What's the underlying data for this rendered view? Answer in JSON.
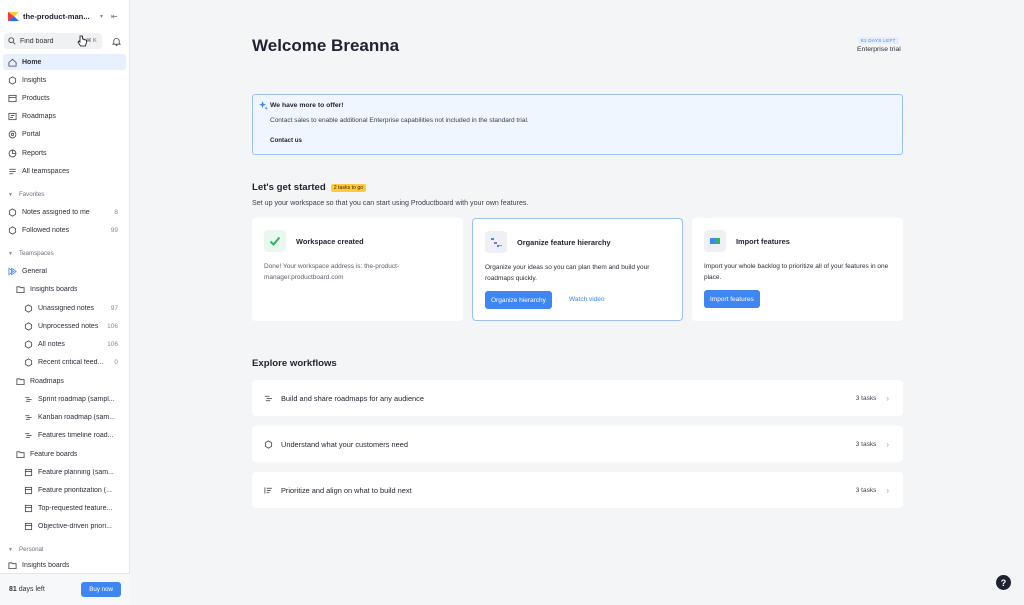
{
  "workspace": {
    "name": "the-product-man..."
  },
  "search": {
    "placeholder": "Find board",
    "shortcut": "⌘ K"
  },
  "nav": [
    {
      "label": "Home",
      "icon": "home-icon",
      "active": true
    },
    {
      "label": "Insights",
      "icon": "insights-icon"
    },
    {
      "label": "Products",
      "icon": "products-icon"
    },
    {
      "label": "Roadmaps",
      "icon": "roadmaps-icon"
    },
    {
      "label": "Portal",
      "icon": "portal-icon"
    },
    {
      "label": "Reports",
      "icon": "reports-icon"
    },
    {
      "label": "All teamspaces",
      "icon": "teamspaces-icon"
    }
  ],
  "favorites": {
    "header": "Favorites",
    "items": [
      {
        "label": "Notes assigned to me",
        "count": "8"
      },
      {
        "label": "Followed notes",
        "count": "99"
      }
    ]
  },
  "teamspaces": {
    "header": "Teamspaces",
    "general": "General",
    "insights_boards": "Insights boards",
    "insights_items": [
      {
        "label": "Unassigned notes",
        "count": "97"
      },
      {
        "label": "Unprocessed notes",
        "count": "106"
      },
      {
        "label": "All notes",
        "count": "106"
      },
      {
        "label": "Recent critical feed...",
        "count": "0"
      }
    ],
    "roadmaps": "Roadmaps",
    "roadmap_items": [
      {
        "label": "Sprint roadmap (sampl..."
      },
      {
        "label": "Kanban roadmap (sam..."
      },
      {
        "label": "Features timeline road..."
      }
    ],
    "feature_boards": "Feature boards",
    "feature_items": [
      {
        "label": "Feature planning (sam..."
      },
      {
        "label": "Feature prioritization (..."
      },
      {
        "label": "Top-requested feature..."
      },
      {
        "label": "Objective-driven priori..."
      }
    ]
  },
  "personal": {
    "header": "Personal",
    "insights_boards": "Insights boards"
  },
  "footer": {
    "days_num": "81",
    "days_text": " days left",
    "buy": "Buy now"
  },
  "header": {
    "title": "Welcome Breanna",
    "trial_badge": "81 DAYS LEFT",
    "trial_text": "Enterprise trial"
  },
  "offer": {
    "title": "We have more to offer!",
    "body": "Contact sales to enable additional Enterprise capabilities not included in the standard trial.",
    "link": "Contact us"
  },
  "get_started": {
    "title": "Let's get started",
    "badge": "2 tasks to go",
    "subtitle": "Set up your workspace so that you can start using Productboard with your own features.",
    "cards": [
      {
        "title": "Workspace created",
        "body": "Done! Your workspace address is: the-product-manager.productboard.com"
      },
      {
        "title": "Organize feature hierarchy",
        "body": "Organize your ideas so you can plan them and build your roadmaps quickly.",
        "button": "Organize hierarchy",
        "link": "Watch video"
      },
      {
        "title": "Import features",
        "body": "Import your whole backlog to prioritize all of your features in one place.",
        "button": "Import features"
      }
    ]
  },
  "explore": {
    "title": "Explore workflows",
    "rows": [
      {
        "label": "Build and share roadmaps for any audience",
        "count": "3 tasks"
      },
      {
        "label": "Understand what your customers need",
        "count": "3 tasks"
      },
      {
        "label": "Prioritize and align on what to build next",
        "count": "3 tasks"
      }
    ]
  },
  "help": "?",
  "colors": {
    "accent": "#3f86f2",
    "badge": "#ffc83d",
    "success": "#2fb463"
  }
}
